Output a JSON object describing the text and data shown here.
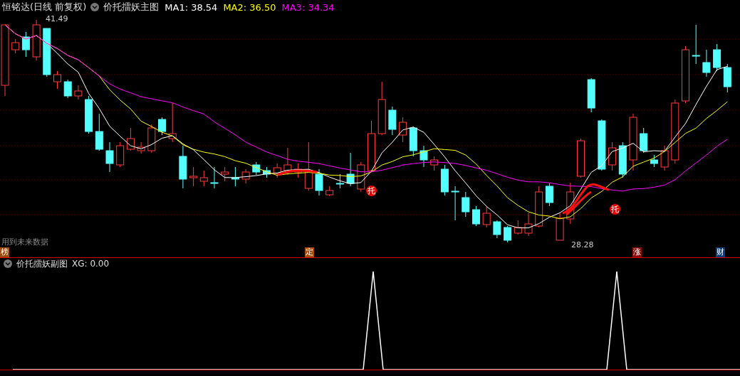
{
  "header": {
    "stock": "恒铭达(日线 前复权)",
    "indicator": "价托擂妖主图",
    "ma": [
      {
        "label": "MA1: 38.54",
        "color": "#ffffff"
      },
      {
        "label": "MA2: 36.50",
        "color": "#ffff00"
      },
      {
        "label": "MA3: 34.34",
        "color": "#ff00ff"
      }
    ]
  },
  "main_chart": {
    "high_label": "41.49",
    "low_label": "28.28",
    "note": "用到未来数据",
    "signals": [
      {
        "label": "托"
      },
      {
        "label": "托"
      }
    ]
  },
  "markers": [
    {
      "label": "榜",
      "color": "#9a4a10"
    },
    {
      "label": "定",
      "color": "#a84a08"
    },
    {
      "label": "涨",
      "color": "#8a0a0a"
    },
    {
      "label": "财",
      "color": "#0c3c78"
    }
  ],
  "sub_chart": {
    "title": "价托擂妖副图",
    "reading": "XG: 0.00"
  }
}
